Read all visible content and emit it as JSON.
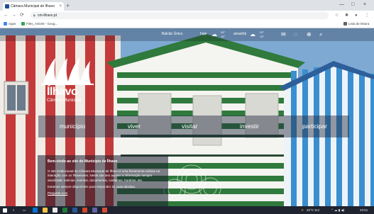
{
  "browser": {
    "tab_title": "Câmara Municipal de Ílhavo",
    "tab_close": "×",
    "new_tab": "+",
    "url": "cm-ilhavo.pt",
    "window_controls": [
      "—",
      "□",
      "×"
    ],
    "bookmarks": [
      "Apps",
      "Files_ASUW - Goog..."
    ],
    "reading_list": "Lista de leitura"
  },
  "site": {
    "topbar": {
      "balcao": "Balcão Único",
      "weather_today_label": "hoje",
      "weather_today_temps": [
        "24°",
        "15°"
      ],
      "weather_tomorrow_label": "amanhã",
      "weather_tomorrow_temps": [
        "22°",
        "15°"
      ]
    },
    "brand": "Ílhavo",
    "subbrand": "Câmara Municipal",
    "nav": [
      "município",
      "viver",
      "visitar",
      "investir",
      "participar"
    ],
    "welcome": {
      "title": "Bem-vindo ao site do Município de Ílhavo",
      "p1": "O site institucional da Câmara Municipal de Ílhavo é uma ferramenta valiosa na interação com os Ílhavenses. Neste site tem acesso a informação sempre atualizada: notícias, eventos, documentos, contactos, horários, etc.",
      "p2": "Estamos sempre disponíveis para responder às suas dúvidas.",
      "link": "Pergunte-nos!"
    }
  },
  "taskbar": {
    "weather": "20°C Sol",
    "time": "23:51"
  },
  "colors": {
    "stripe_red": "#c43a3a",
    "stripe_green": "#2f7a3c",
    "stripe_blue": "#3a8fd0",
    "sky": "#8fb5d8"
  }
}
